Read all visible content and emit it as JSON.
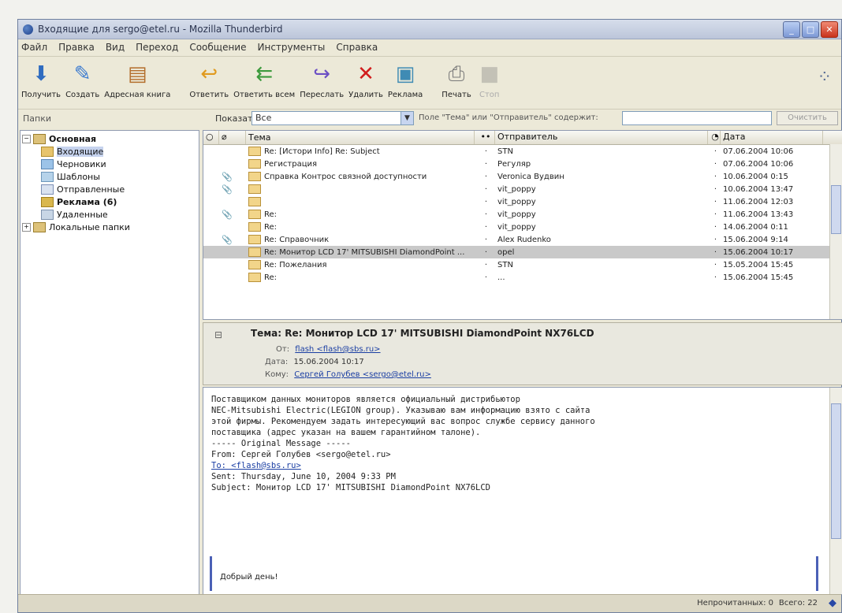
{
  "window": {
    "title": "Входящие для sergo@etel.ru - Mozilla Thunderbird"
  },
  "menu": [
    "Файл",
    "Правка",
    "Вид",
    "Переход",
    "Сообщение",
    "Инструменты",
    "Справка"
  ],
  "toolbar": {
    "buttons": [
      {
        "label": "Получить",
        "icon": "get-mail-icon"
      },
      {
        "label": "Создать",
        "icon": "write-icon"
      },
      {
        "label": "Адресная книга",
        "icon": "address-book-icon"
      },
      {
        "label": "Ответить",
        "icon": "reply-icon"
      },
      {
        "label": "Ответить всем",
        "icon": "reply-all-icon"
      },
      {
        "label": "Переслать",
        "icon": "forward-icon"
      },
      {
        "label": "Удалить",
        "icon": "delete-icon"
      },
      {
        "label": "Реклама",
        "icon": "junk-icon"
      },
      {
        "label": "Печать",
        "icon": "print-icon"
      },
      {
        "label": "Стоп",
        "icon": "stop-icon",
        "disabled": true
      }
    ]
  },
  "search": {
    "folders_label": "Папки",
    "show_label": "Показать:",
    "show_value": "Все",
    "hint": "Поле \"Тема\" или \"Отправитель\" содержит:",
    "clear_label": "Очистить"
  },
  "folders": {
    "account": "Основная",
    "items": [
      {
        "label": "Входящие",
        "icon": "inbox"
      },
      {
        "label": "Черновики",
        "icon": "draft"
      },
      {
        "label": "Шаблоны",
        "icon": "tpl"
      },
      {
        "label": "Отправленные",
        "icon": "sent"
      },
      {
        "label": "Реклама (6)",
        "icon": "junk"
      },
      {
        "label": "Удаленные",
        "icon": "trash"
      }
    ],
    "local": "Локальные папки"
  },
  "thread": {
    "columns": {
      "subject": "Тема",
      "from": "Отправитель",
      "date": "Дата"
    },
    "rows": [
      {
        "attach": false,
        "subject": "Re: [Истори Info] Re: Subject",
        "from": "STN",
        "date": "07.06.2004 10:06"
      },
      {
        "attach": false,
        "subject": "Регистрация",
        "from": "Регуляр",
        "date": "07.06.2004 10:06"
      },
      {
        "attach": true,
        "subject": "Справка Контрос связной доступности",
        "from": "Veronica Вудвин",
        "date": "10.06.2004 0:15"
      },
      {
        "attach": true,
        "subject": "",
        "from": "vit_poppy",
        "date": "10.06.2004 13:47"
      },
      {
        "attach": false,
        "subject": "",
        "from": "vit_poppy",
        "date": "11.06.2004 12:03"
      },
      {
        "attach": true,
        "subject": "Re:",
        "from": "vit_poppy",
        "date": "11.06.2004 13:43"
      },
      {
        "attach": false,
        "subject": "Re:",
        "from": "vit_poppy",
        "date": "14.06.2004 0:11"
      },
      {
        "attach": true,
        "subject": "Re: Справочник",
        "from": "Alex Rudenko",
        "date": "15.06.2004 9:14"
      },
      {
        "attach": false,
        "subject": "Re: Монитор LCD 17' MITSUBISHI DiamondPoint ...",
        "from": "opel",
        "date": "15.06.2004 10:17",
        "selected": true
      },
      {
        "attach": false,
        "subject": "Re: Пожелания",
        "from": "STN",
        "date": "15.05.2004 15:45"
      },
      {
        "attach": false,
        "subject": "Re:",
        "from": "...",
        "date": "15.06.2004 15:45"
      }
    ]
  },
  "message": {
    "subject_key": "Тема:",
    "subject": "Re: Монитор LCD 17' MITSUBISHI DiamondPoint NX76LCD",
    "from_key": "От:",
    "from": "flash <flash@sbs.ru>",
    "date_key": "Дата:",
    "date": "15.06.2004 10:17",
    "to_key": "Кому:",
    "to": "Сергей Голубев <sergo@etel.ru>",
    "body_lines": [
      "Поставщиком данных мониторов является официальный дистрибьютор",
      "NEC-Mitsubishi Electric(LEGION group). Указываю вам информацию взято с сайта",
      "этой фирмы. Рекомендуем задать интересующий вас вопрос службе сервису данного",
      "поставщика (адрес указан на вашем гарантийном талоне).",
      "",
      "----- Original Message -----",
      "From: Сергей Голубев <sergo@etel.ru>",
      "To: <flash@sbs.ru>",
      "Sent: Thursday, June 10, 2004 9:33 PM",
      "Subject: Монитор LCD 17' MITSUBISHI DiamondPoint NX76LCD"
    ],
    "quote_text": "Добрый день!"
  },
  "status": {
    "unread": "Непрочитанных: 0",
    "total": "Всего: 22"
  }
}
